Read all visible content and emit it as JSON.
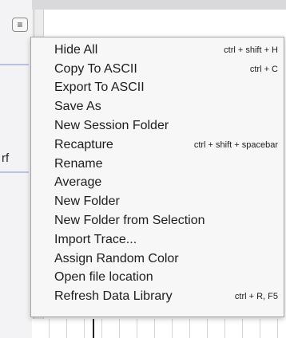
{
  "menu": {
    "items": [
      {
        "label": "Hide All",
        "shortcut": "ctrl + shift + H"
      },
      {
        "label": "Copy To ASCII",
        "shortcut": "ctrl + C"
      },
      {
        "label": "Export To ASCII",
        "shortcut": ""
      },
      {
        "label": "Save As",
        "shortcut": ""
      },
      {
        "label": "New Session Folder",
        "shortcut": ""
      },
      {
        "label": "Recapture",
        "shortcut": "ctrl + shift + spacebar"
      },
      {
        "label": "Rename",
        "shortcut": ""
      },
      {
        "label": "Average",
        "shortcut": ""
      },
      {
        "label": "New Folder",
        "shortcut": ""
      },
      {
        "label": "New Folder from Selection",
        "shortcut": ""
      },
      {
        "label": "Import Trace...",
        "shortcut": ""
      },
      {
        "label": "Assign Random Color",
        "shortcut": ""
      },
      {
        "label": "Open file location",
        "shortcut": ""
      },
      {
        "label": "Refresh Data Library",
        "shortcut": "ctrl + R, F5"
      }
    ]
  },
  "background": {
    "partial_text": "rf",
    "menu_button_icon": "hamburger-icon"
  }
}
